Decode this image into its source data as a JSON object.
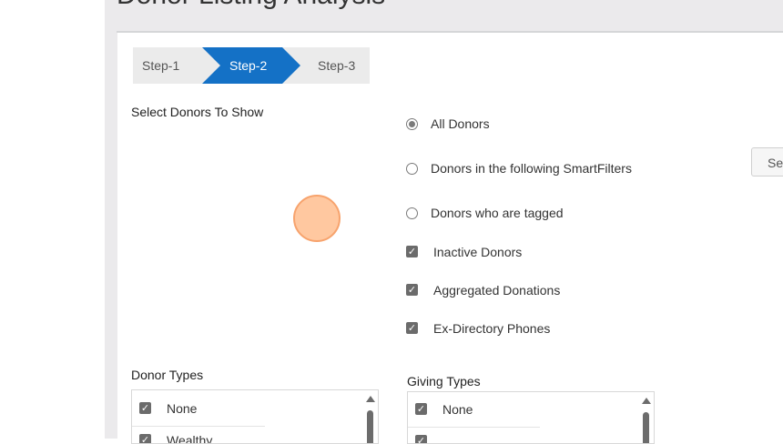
{
  "page": {
    "title_partial": "Donor Listing Analysis"
  },
  "steps": [
    {
      "label": "Step-1",
      "active": false
    },
    {
      "label": "Step-2",
      "active": true
    },
    {
      "label": "Step-3",
      "active": false
    }
  ],
  "select_donors": {
    "label": "Select Donors To Show",
    "radio_options": [
      {
        "label": "All Donors",
        "selected": true
      },
      {
        "label": "Donors in the following SmartFilters",
        "selected": false
      },
      {
        "label": "Donors who are tagged",
        "selected": false
      }
    ],
    "checkboxes": [
      {
        "label": "Inactive Donors",
        "checked": true
      },
      {
        "label": "Aggregated Donations",
        "checked": true
      },
      {
        "label": "Ex-Directory Phones",
        "checked": true
      }
    ],
    "side_button_label": "Sel"
  },
  "donor_types": {
    "label": "Donor Types",
    "items": [
      {
        "label": "None",
        "checked": true
      },
      {
        "label": "Wealthy",
        "checked": true
      }
    ]
  },
  "giving_types": {
    "label": "Giving Types",
    "items": [
      {
        "label": "None",
        "checked": true
      },
      {
        "label": "",
        "checked": true
      }
    ]
  },
  "colors": {
    "active_step": "#1471c6",
    "inactive_step": "#ebebeb",
    "checkbox": "#6b6b6b",
    "cursor_highlight": "#ffb580"
  },
  "icons": {
    "check": "✓",
    "scroll_up": "triangle-up"
  }
}
